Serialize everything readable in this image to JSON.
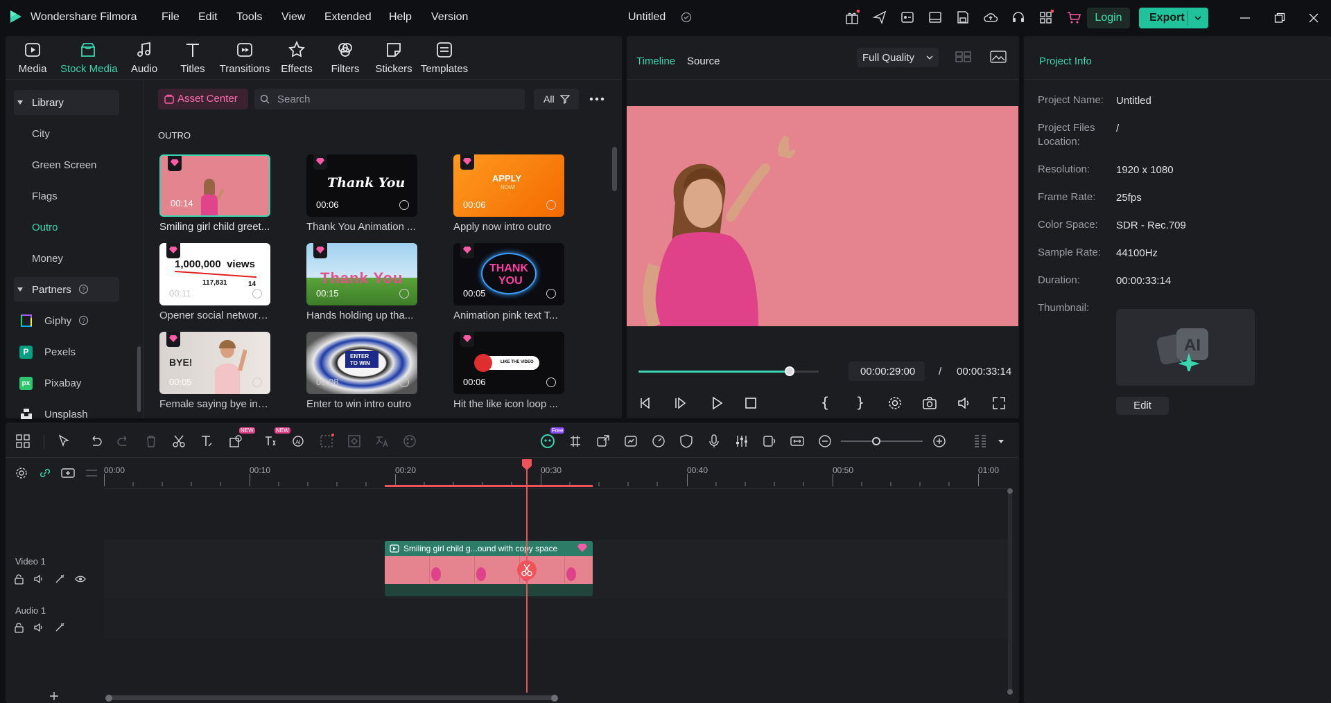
{
  "app": {
    "name": "Wondershare Filmora",
    "project_title": "Untitled",
    "menu": [
      "File",
      "Edit",
      "Tools",
      "View",
      "Extended",
      "Help",
      "Version"
    ],
    "login_label": "Login",
    "export_label": "Export"
  },
  "media_tabs": [
    {
      "label": "Media",
      "icon": "media-icon"
    },
    {
      "label": "Stock Media",
      "icon": "stock-media-icon"
    },
    {
      "label": "Audio",
      "icon": "audio-icon"
    },
    {
      "label": "Titles",
      "icon": "titles-icon"
    },
    {
      "label": "Transitions",
      "icon": "transitions-icon"
    },
    {
      "label": "Effects",
      "icon": "effects-icon"
    },
    {
      "label": "Filters",
      "icon": "filters-icon"
    },
    {
      "label": "Stickers",
      "icon": "stickers-icon"
    },
    {
      "label": "Templates",
      "icon": "templates-icon"
    }
  ],
  "library": {
    "header": "Library",
    "items": [
      "City",
      "Green Screen",
      "Flags",
      "Outro",
      "Money"
    ],
    "partners_header": "Partners",
    "partners": [
      "Giphy",
      "Pexels",
      "Pixabay",
      "Unsplash"
    ]
  },
  "browser": {
    "asset_center": "Asset Center",
    "search_placeholder": "Search",
    "filter_label": "All",
    "section": "OUTRO",
    "cards": [
      {
        "title": "Smiling girl child greet...",
        "duration": "00:14"
      },
      {
        "title": "Thank You Animation ...",
        "duration": "00:06",
        "overlay": "Thank You"
      },
      {
        "title": "Apply now intro outro",
        "duration": "00:06",
        "overlay": "APPLY",
        "overlay2": "NOW!"
      },
      {
        "title": "Opener social network...",
        "duration": "00:11",
        "overlay": "1,000,000  views",
        "overlay2": "117,831",
        "overlay3": "14"
      },
      {
        "title": "Hands holding up tha...",
        "duration": "00:15",
        "overlay": "Thank You"
      },
      {
        "title": "Animation pink text T...",
        "duration": "00:05",
        "overlay": "THANK",
        "overlay2": "YOU"
      },
      {
        "title": "Female saying bye in s...",
        "duration": "00:05",
        "overlay": "BYE!"
      },
      {
        "title": "Enter to win intro outro",
        "duration": "00:08",
        "overlay": "ENTER",
        "overlay2": "TO WIN"
      },
      {
        "title": "Hit the like icon loop ...",
        "duration": "00:06",
        "overlay": "LIKE THE VIDEO"
      }
    ]
  },
  "preview": {
    "tab_timeline": "Timeline",
    "tab_source": "Source",
    "quality": "Full Quality",
    "current_time": "00:00:29:00",
    "separator": "/",
    "total_time": "00:00:33:14",
    "progress": 0.84
  },
  "project_info": {
    "header": "Project Info",
    "rows": [
      {
        "label": "Project Name:",
        "value": "Untitled"
      },
      {
        "label": "Project Files Location:",
        "value": "/"
      },
      {
        "label": "Resolution:",
        "value": "1920 x 1080"
      },
      {
        "label": "Frame Rate:",
        "value": "25fps"
      },
      {
        "label": "Color Space:",
        "value": "SDR - Rec.709"
      },
      {
        "label": "Sample Rate:",
        "value": "44100Hz"
      },
      {
        "label": "Duration:",
        "value": "00:00:33:14"
      },
      {
        "label": "Thumbnail:",
        "value": ""
      }
    ],
    "edit_label": "Edit"
  },
  "timeline": {
    "ruler": [
      "00:00",
      "00:10",
      "00:20",
      "00:30",
      "00:40",
      "00:50",
      "01:00"
    ],
    "tracks": [
      {
        "name": "Video 1"
      },
      {
        "name": "Audio 1"
      }
    ],
    "clip_title": "Smiling girl child g...ound with copy space",
    "badge_new": "NEW",
    "badge_free": "Free"
  },
  "colors": {
    "accent": "#39d6b0",
    "export": "#1fc29a",
    "playhead": "#f0525a",
    "preview_bg": "#e5848f",
    "clip": "#2c7d68"
  }
}
